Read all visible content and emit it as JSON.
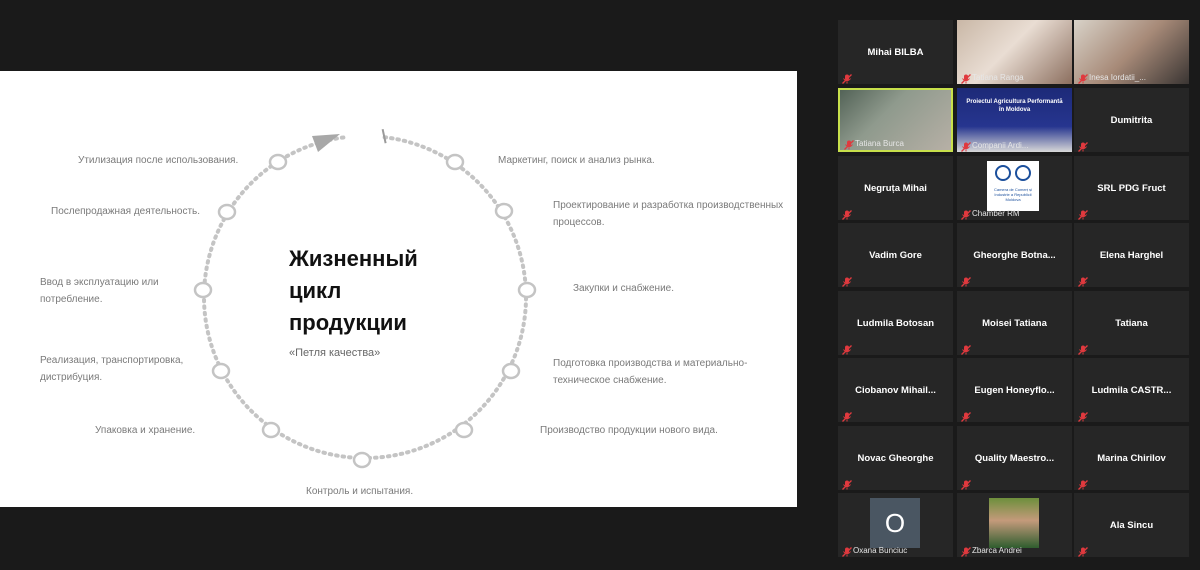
{
  "slide": {
    "title": "Жизненный\nцикл\nпродукции",
    "subtitle": "«Петля качества»",
    "steps": [
      "Маркетинг, поиск и анализ рынка.",
      "Проектирование и разработка производственных процессов.",
      "Закупки и снабжение.",
      "Подготовка производства и материально-техническое снабжение.",
      "Производство продукции нового вида.",
      "Контроль и испытания.",
      "Упаковка и хранение.",
      "Реализация, транспортировка, дистрибуция.",
      "Ввод в эксплуатацию или потребление.",
      "Послепродажная деятельность.",
      "Утилизация после использования."
    ]
  },
  "participants": [
    {
      "name": "Mihai BILBA",
      "label": "",
      "video": false
    },
    {
      "name": "",
      "label": "Tatiana Ranga",
      "video": true
    },
    {
      "name": "",
      "label": "Inesa Iordatii_...",
      "video": true
    },
    {
      "name": "",
      "label": "Tatiana Burca",
      "video": true,
      "active": true
    },
    {
      "name": "",
      "label": "Companii Ardi...",
      "video": true,
      "banner": "Proiectul Agricultura Performantă în Moldova"
    },
    {
      "name": "Dumitrita",
      "label": "",
      "video": false
    },
    {
      "name": "Negruța Mihai",
      "label": "",
      "video": false
    },
    {
      "name": "",
      "label": "Chamber RM",
      "video": true,
      "logo": "Camera de Comerț și Industrie a Republicii Moldova"
    },
    {
      "name": "SRL PDG Fruct",
      "label": "",
      "video": false
    },
    {
      "name": "Vadim Gore",
      "label": "",
      "video": false
    },
    {
      "name": "Gheorghe  Botna...",
      "label": "",
      "video": false
    },
    {
      "name": "Elena Harghel",
      "label": "",
      "video": false
    },
    {
      "name": "Ludmila Botosan",
      "label": "",
      "video": false
    },
    {
      "name": "Moisei Tatiana",
      "label": "",
      "video": false
    },
    {
      "name": "Tatiana",
      "label": "",
      "video": false
    },
    {
      "name": "Ciobanov  Mihail...",
      "label": "",
      "video": false
    },
    {
      "name": "Eugen  Honeyflo...",
      "label": "",
      "video": false
    },
    {
      "name": "Ludmila  CASTR...",
      "label": "",
      "video": false
    },
    {
      "name": "Novac Gheorghe",
      "label": "",
      "video": false
    },
    {
      "name": "Quality  Maestro...",
      "label": "",
      "video": false
    },
    {
      "name": "Marina Chirilov",
      "label": "",
      "video": false
    },
    {
      "name": "",
      "label": "Oxana Bunciuc",
      "video": false,
      "avatar": "O"
    },
    {
      "name": "",
      "label": "Zbarca Andrei",
      "video": true
    },
    {
      "name": "Ala Sincu",
      "label": "",
      "video": false
    }
  ],
  "colors": {
    "background": "#1a1a1a",
    "tile": "#262626",
    "active_border": "#c8e04b",
    "muted_icon": "#e0393e",
    "loop": "#c4c4c4"
  }
}
